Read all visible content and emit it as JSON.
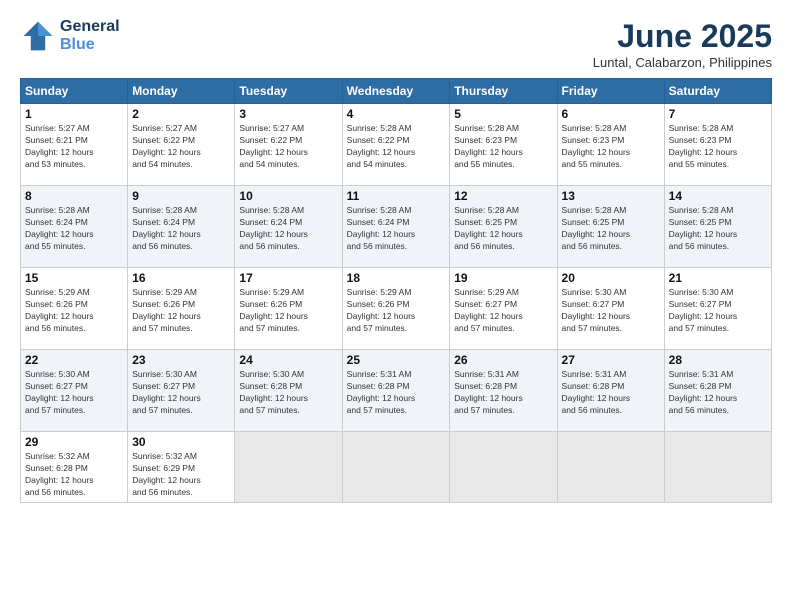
{
  "logo": {
    "line1": "General",
    "line2": "Blue"
  },
  "title": "June 2025",
  "location": "Luntal, Calabarzon, Philippines",
  "weekdays": [
    "Sunday",
    "Monday",
    "Tuesday",
    "Wednesday",
    "Thursday",
    "Friday",
    "Saturday"
  ],
  "weeks": [
    [
      {
        "day": "1",
        "info": "Sunrise: 5:27 AM\nSunset: 6:21 PM\nDaylight: 12 hours\nand 53 minutes."
      },
      {
        "day": "2",
        "info": "Sunrise: 5:27 AM\nSunset: 6:22 PM\nDaylight: 12 hours\nand 54 minutes."
      },
      {
        "day": "3",
        "info": "Sunrise: 5:27 AM\nSunset: 6:22 PM\nDaylight: 12 hours\nand 54 minutes."
      },
      {
        "day": "4",
        "info": "Sunrise: 5:28 AM\nSunset: 6:22 PM\nDaylight: 12 hours\nand 54 minutes."
      },
      {
        "day": "5",
        "info": "Sunrise: 5:28 AM\nSunset: 6:23 PM\nDaylight: 12 hours\nand 55 minutes."
      },
      {
        "day": "6",
        "info": "Sunrise: 5:28 AM\nSunset: 6:23 PM\nDaylight: 12 hours\nand 55 minutes."
      },
      {
        "day": "7",
        "info": "Sunrise: 5:28 AM\nSunset: 6:23 PM\nDaylight: 12 hours\nand 55 minutes."
      }
    ],
    [
      {
        "day": "8",
        "info": "Sunrise: 5:28 AM\nSunset: 6:24 PM\nDaylight: 12 hours\nand 55 minutes."
      },
      {
        "day": "9",
        "info": "Sunrise: 5:28 AM\nSunset: 6:24 PM\nDaylight: 12 hours\nand 56 minutes."
      },
      {
        "day": "10",
        "info": "Sunrise: 5:28 AM\nSunset: 6:24 PM\nDaylight: 12 hours\nand 56 minutes."
      },
      {
        "day": "11",
        "info": "Sunrise: 5:28 AM\nSunset: 6:24 PM\nDaylight: 12 hours\nand 56 minutes."
      },
      {
        "day": "12",
        "info": "Sunrise: 5:28 AM\nSunset: 6:25 PM\nDaylight: 12 hours\nand 56 minutes."
      },
      {
        "day": "13",
        "info": "Sunrise: 5:28 AM\nSunset: 6:25 PM\nDaylight: 12 hours\nand 56 minutes."
      },
      {
        "day": "14",
        "info": "Sunrise: 5:28 AM\nSunset: 6:25 PM\nDaylight: 12 hours\nand 56 minutes."
      }
    ],
    [
      {
        "day": "15",
        "info": "Sunrise: 5:29 AM\nSunset: 6:26 PM\nDaylight: 12 hours\nand 56 minutes."
      },
      {
        "day": "16",
        "info": "Sunrise: 5:29 AM\nSunset: 6:26 PM\nDaylight: 12 hours\nand 57 minutes."
      },
      {
        "day": "17",
        "info": "Sunrise: 5:29 AM\nSunset: 6:26 PM\nDaylight: 12 hours\nand 57 minutes."
      },
      {
        "day": "18",
        "info": "Sunrise: 5:29 AM\nSunset: 6:26 PM\nDaylight: 12 hours\nand 57 minutes."
      },
      {
        "day": "19",
        "info": "Sunrise: 5:29 AM\nSunset: 6:27 PM\nDaylight: 12 hours\nand 57 minutes."
      },
      {
        "day": "20",
        "info": "Sunrise: 5:30 AM\nSunset: 6:27 PM\nDaylight: 12 hours\nand 57 minutes."
      },
      {
        "day": "21",
        "info": "Sunrise: 5:30 AM\nSunset: 6:27 PM\nDaylight: 12 hours\nand 57 minutes."
      }
    ],
    [
      {
        "day": "22",
        "info": "Sunrise: 5:30 AM\nSunset: 6:27 PM\nDaylight: 12 hours\nand 57 minutes."
      },
      {
        "day": "23",
        "info": "Sunrise: 5:30 AM\nSunset: 6:27 PM\nDaylight: 12 hours\nand 57 minutes."
      },
      {
        "day": "24",
        "info": "Sunrise: 5:30 AM\nSunset: 6:28 PM\nDaylight: 12 hours\nand 57 minutes."
      },
      {
        "day": "25",
        "info": "Sunrise: 5:31 AM\nSunset: 6:28 PM\nDaylight: 12 hours\nand 57 minutes."
      },
      {
        "day": "26",
        "info": "Sunrise: 5:31 AM\nSunset: 6:28 PM\nDaylight: 12 hours\nand 57 minutes."
      },
      {
        "day": "27",
        "info": "Sunrise: 5:31 AM\nSunset: 6:28 PM\nDaylight: 12 hours\nand 56 minutes."
      },
      {
        "day": "28",
        "info": "Sunrise: 5:31 AM\nSunset: 6:28 PM\nDaylight: 12 hours\nand 56 minutes."
      }
    ],
    [
      {
        "day": "29",
        "info": "Sunrise: 5:32 AM\nSunset: 6:28 PM\nDaylight: 12 hours\nand 56 minutes."
      },
      {
        "day": "30",
        "info": "Sunrise: 5:32 AM\nSunset: 6:29 PM\nDaylight: 12 hours\nand 56 minutes."
      },
      {
        "day": "",
        "info": ""
      },
      {
        "day": "",
        "info": ""
      },
      {
        "day": "",
        "info": ""
      },
      {
        "day": "",
        "info": ""
      },
      {
        "day": "",
        "info": ""
      }
    ]
  ]
}
